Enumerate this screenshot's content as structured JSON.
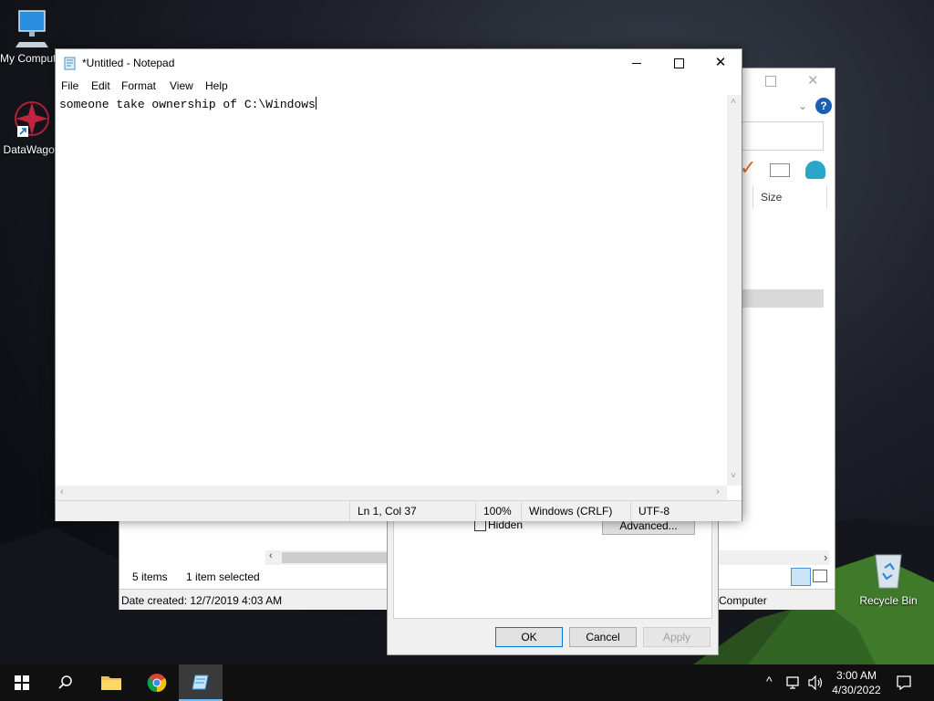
{
  "desktop": {
    "icons": [
      {
        "label": "My Computer"
      },
      {
        "label": "DataWagon"
      },
      {
        "label": "Recycle Bin"
      }
    ]
  },
  "notepad": {
    "title": "*Untitled - Notepad",
    "menu": [
      "File",
      "Edit",
      "Format",
      "View",
      "Help"
    ],
    "content": "someone take ownership of C:\\Windows",
    "status": {
      "position": "Ln 1, Col 37",
      "zoom": "100%",
      "line_ending": "Windows (CRLF)",
      "encoding": "UTF-8"
    }
  },
  "explorer": {
    "column_size": "Size",
    "status_items": "5 items",
    "status_selected": "1 item selected",
    "date_created": "Date created: 12/7/2019 4:03 AM",
    "location": "Computer"
  },
  "properties_dialog": {
    "hidden_label": "Hidden",
    "advanced_label": "Advanced...",
    "ok": "OK",
    "cancel": "Cancel",
    "apply": "Apply"
  },
  "taskbar": {
    "time": "3:00 AM",
    "date": "4/30/2022"
  },
  "colors": {
    "accent": "#0078d7",
    "taskbar": "#101010",
    "help_icon": "#1a5fb4"
  }
}
